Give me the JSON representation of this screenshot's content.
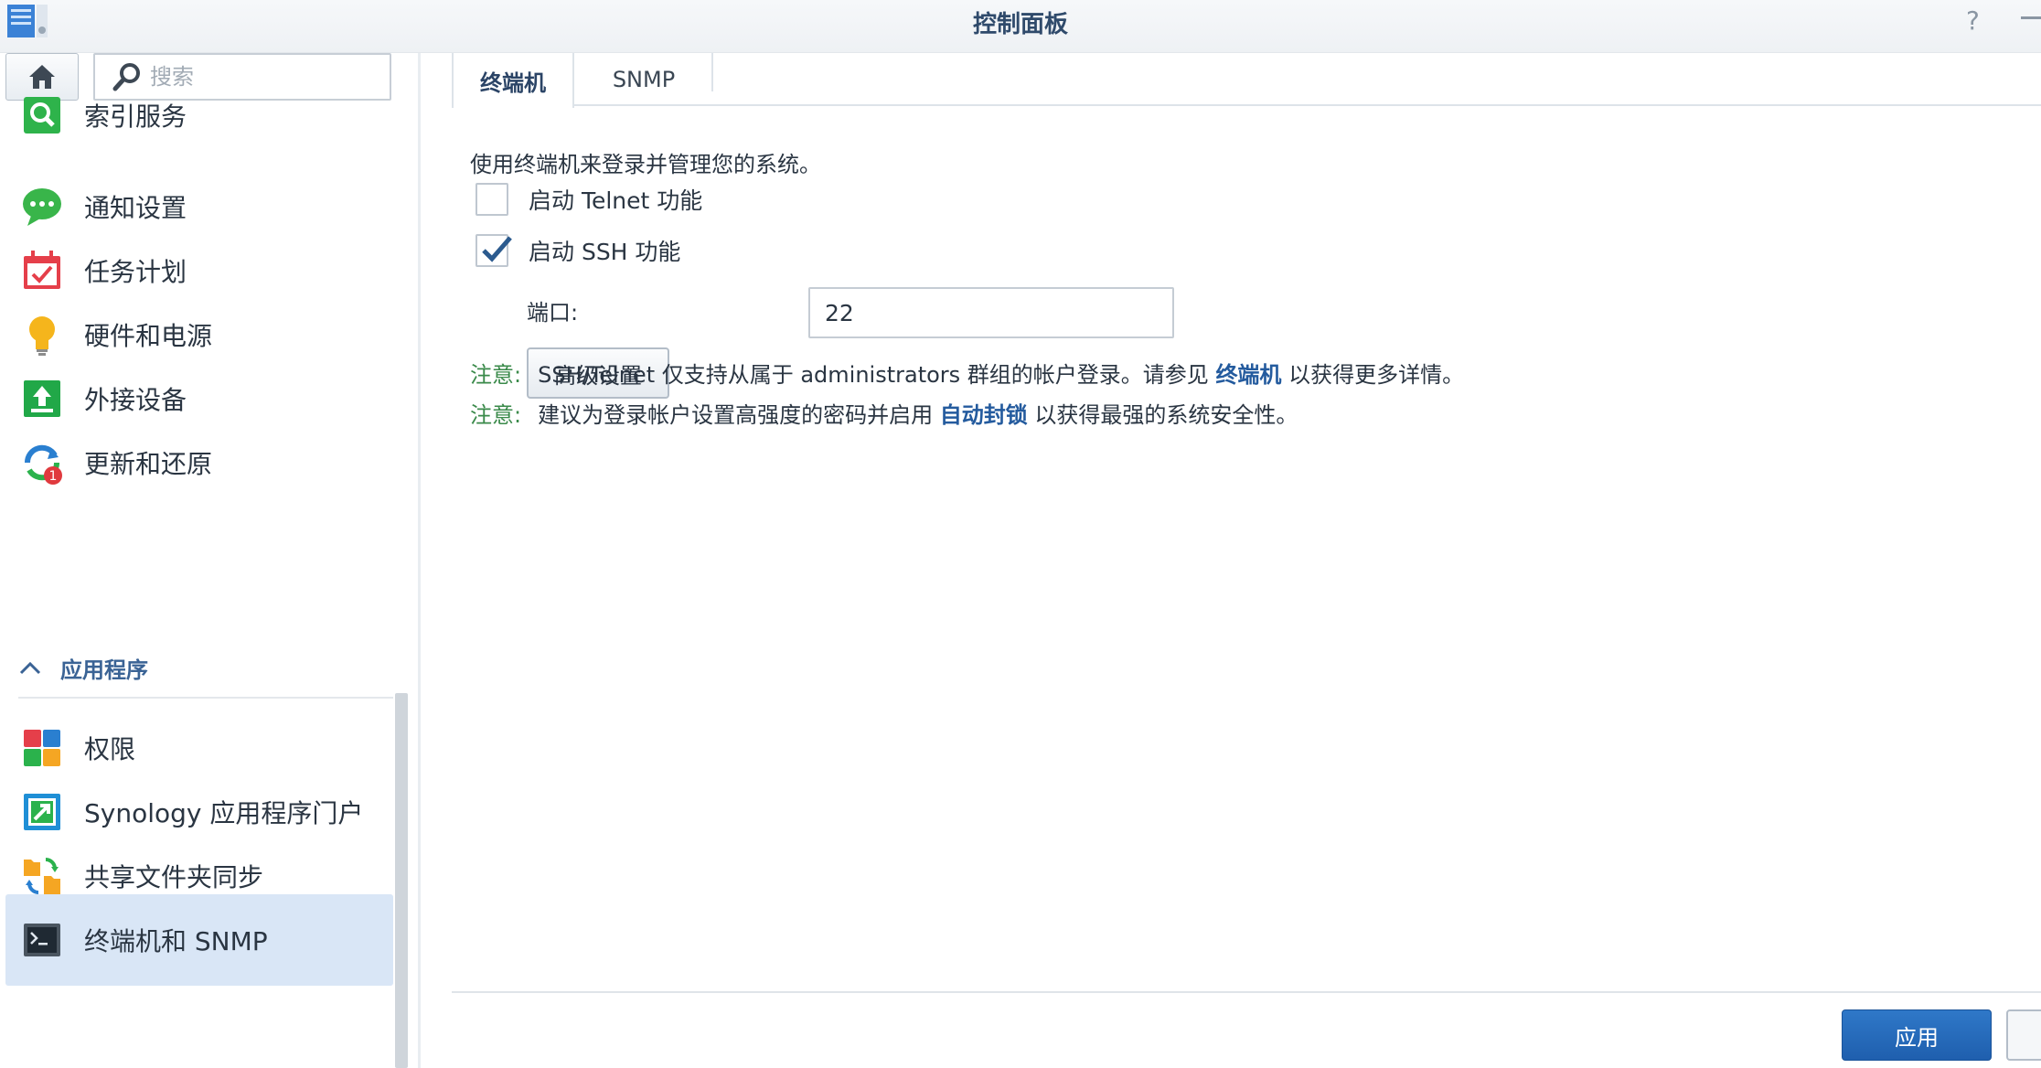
{
  "window": {
    "title": "控制面板"
  },
  "search": {
    "placeholder": "搜索"
  },
  "sidebar": {
    "items": [
      {
        "label": "索引服务",
        "icon": "index-search-icon"
      },
      {
        "label": "通知设置",
        "icon": "chat-bubble-icon"
      },
      {
        "label": "任务计划",
        "icon": "calendar-check-icon"
      },
      {
        "label": "硬件和电源",
        "icon": "lightbulb-icon"
      },
      {
        "label": "外接设备",
        "icon": "upload-device-icon"
      },
      {
        "label": "更新和还原",
        "icon": "refresh-icon",
        "badge": "1"
      }
    ],
    "section": {
      "label": "应用程序"
    },
    "app_items": [
      {
        "label": "权限",
        "icon": "privileges-icon"
      },
      {
        "label": "Synology 应用程序门户",
        "icon": "portal-arrow-icon"
      },
      {
        "label": "共享文件夹同步",
        "icon": "folder-sync-icon"
      },
      {
        "label": "终端机和 SNMP",
        "icon": "terminal-icon",
        "active": true
      }
    ]
  },
  "tabs": [
    {
      "label": "终端机",
      "active": true
    },
    {
      "label": "SNMP",
      "active": false
    }
  ],
  "main": {
    "description": "使用终端机来登录并管理您的系统。",
    "telnet": {
      "label": "启动 Telnet 功能",
      "checked": false
    },
    "ssh": {
      "label": "启动 SSH 功能",
      "checked": true
    },
    "port": {
      "label": "端口:",
      "value": "22"
    },
    "advanced_button": "高级设置",
    "note1": {
      "prefix": "注意:",
      "text_before": "SSH/Telnet 仅支持从属于 administrators 群组的帐户登录。请参见 ",
      "link": "终端机",
      "text_after": " 以获得更多详情。"
    },
    "note2": {
      "prefix": "注意:",
      "text_before": "建议为登录帐户设置高强度的密码并启用 ",
      "link": "自动封锁",
      "text_after": " 以获得最强的系统安全性。"
    }
  },
  "footer": {
    "apply_label": "应用"
  },
  "colors": {
    "accent": "#1f5fae",
    "link": "#245b9e",
    "note": "#3a8a4a",
    "active_bg": "#d9e6f6"
  }
}
